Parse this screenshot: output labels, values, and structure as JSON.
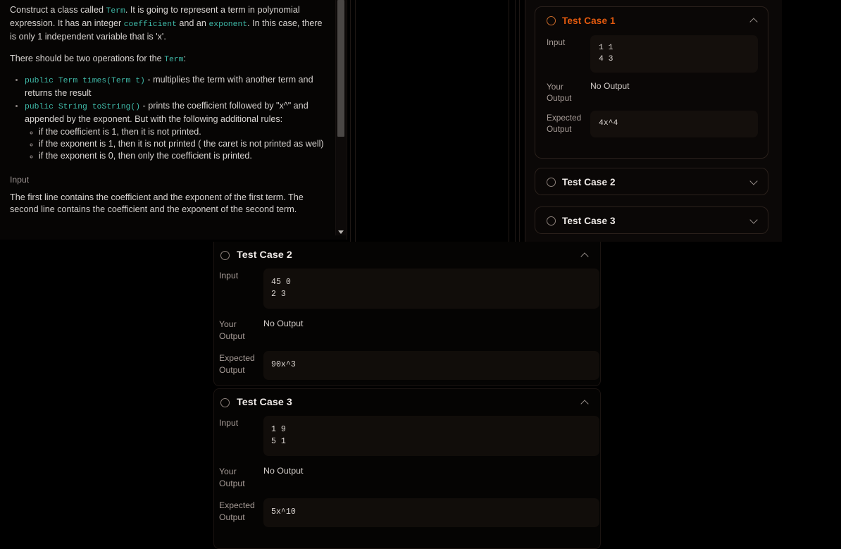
{
  "problem": {
    "paragraphs": [
      {
        "id": "intro",
        "parts": [
          {
            "t": "text",
            "v": "Construct a class called "
          },
          {
            "t": "code",
            "v": "Term"
          },
          {
            "t": "text",
            "v": ". It is going to represent a term in polynomial expression. It has an integer "
          },
          {
            "t": "code",
            "v": "coefficient"
          },
          {
            "t": "text",
            "v": " and an "
          },
          {
            "t": "code",
            "v": "exponent"
          },
          {
            "t": "text",
            "v": ". In this case, there is only 1 independent variable that is 'x'."
          }
        ]
      }
    ],
    "intro_a": "Construct a class called ",
    "intro_code1": "Term",
    "intro_b": ". It is going to represent a term in polynomial expression. It has an integer ",
    "intro_code2": "coefficient",
    "intro_c": " and an ",
    "intro_code3": "exponent",
    "intro_d": ". In this case, there is only 1 independent variable that is 'x'.",
    "ops_lead_a": "There should be two operations for the ",
    "ops_lead_code": "Term",
    "ops_lead_b": ":",
    "bullet1_code": "public Term times(Term t)",
    "bullet1_text": " - multiplies the term with another term and returns the result",
    "bullet2_code": "public String toString()",
    "bullet2_text": " - prints the coefficient followed by \"x^\" and appended by the exponent. But with the following additional rules:",
    "subrules": [
      "if the coefficient is 1, then it is not printed.",
      "if the exponent is 1, then it is not printed ( the caret is not printed as well)",
      "if the exponent is 0, then only the coefficient is printed."
    ],
    "input_heading": "Input",
    "input_text": "The first line contains the coefficient and the exponent of the first term. The second line contains the coefficient and the exponent of the second term."
  },
  "labels": {
    "input": "Input",
    "your_output": "Your Output",
    "expected_output": "Expected Output",
    "no_output": "No Output"
  },
  "colors": {
    "accent_orange": "#e2590e",
    "code_teal": "#3fb9a8",
    "page_bg": "#000000",
    "card_bg": "#0a0706",
    "codebox_bg": "#140f0c"
  },
  "rail": {
    "cases": [
      {
        "title": "Test Case 1",
        "state": "active",
        "expanded": true,
        "chevron": "chevron-up-icon",
        "input": "1 1\n4 3",
        "your_output": "No Output",
        "expected_output": "4x^4"
      },
      {
        "title": "Test Case 2",
        "state": "idle",
        "expanded": false,
        "chevron": "chevron-down-icon"
      },
      {
        "title": "Test Case 3",
        "state": "idle",
        "expanded": false,
        "chevron": "chevron-down-icon"
      }
    ]
  },
  "list": {
    "cases": [
      {
        "title": "Test Case 2",
        "expanded": true,
        "chevron": "chevron-up-icon",
        "input": "45 0\n2 3",
        "your_output": "No Output",
        "expected_output": "90x^3"
      },
      {
        "title": "Test Case 3",
        "expanded": true,
        "chevron": "chevron-up-icon",
        "input": "1 9\n5 1",
        "your_output": "No Output",
        "expected_output": "5x^10"
      }
    ]
  }
}
